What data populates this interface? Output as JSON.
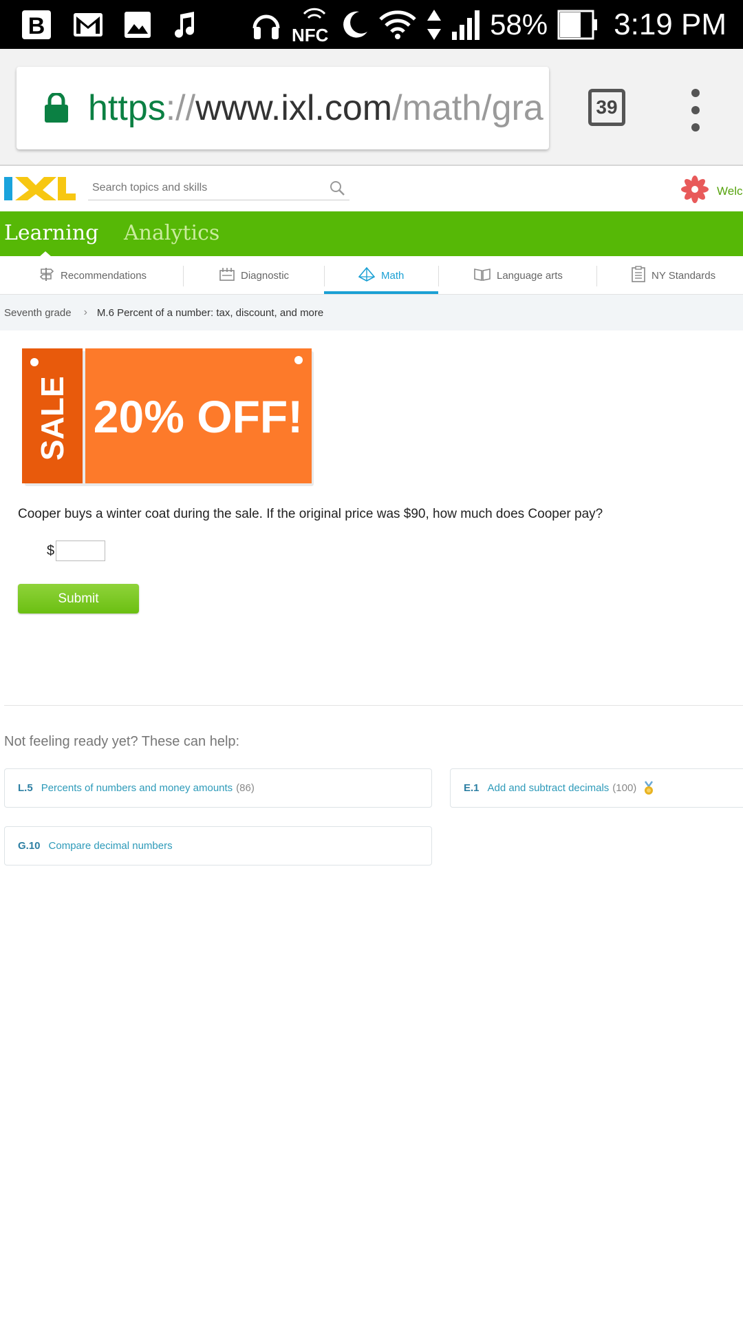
{
  "status_bar": {
    "icons": [
      "b-app-icon",
      "gmail-icon",
      "gallery-icon",
      "music-note-icon",
      "headphones-icon",
      "nfc-icon",
      "moon-icon",
      "wifi-icon",
      "data-arrows-icon",
      "signal-icon"
    ],
    "battery": "58%",
    "time": "3:19 PM"
  },
  "browser": {
    "url_scheme": "https",
    "url_sep": "://",
    "url_host": "www.ixl.com",
    "url_path": "/math/gra",
    "tab_count": "39",
    "lock_color": "#0b8043"
  },
  "header": {
    "logo_text": "IXL",
    "search_placeholder": "Search topics and skills",
    "welcome": "Welcome"
  },
  "main_nav": {
    "learning": "Learning",
    "analytics": "Analytics"
  },
  "subject_tabs": [
    {
      "label": "Recommendations",
      "icon": "signpost-icon"
    },
    {
      "label": "Diagnostic",
      "icon": "diagnostic-icon"
    },
    {
      "label": "Math",
      "icon": "pyramid-icon"
    },
    {
      "label": "Language arts",
      "icon": "book-icon"
    },
    {
      "label": "NY Standards",
      "icon": "clipboard-icon"
    }
  ],
  "breadcrumb": {
    "grade": "Seventh grade",
    "skill": "M.6 Percent of a number: tax, discount, and more"
  },
  "sale_sign": {
    "side_text": "SALE",
    "main_text": "20% OFF!",
    "colors": {
      "side": "#e85a0c",
      "main": "#fd7a2a"
    }
  },
  "question": {
    "text": "Cooper buys a winter coat during the sale. If the original price was $90, how much does Cooper pay?",
    "currency": "$",
    "answer_value": "",
    "submit_label": "Submit"
  },
  "help": {
    "title": "Not feeling ready yet? These can help:",
    "skills": [
      {
        "code": "L.5",
        "name": "Percents of numbers and money amounts",
        "score": "(86)",
        "medal": false
      },
      {
        "code": "E.1",
        "name": "Add and subtract decimals",
        "score": "(100)",
        "medal": true
      },
      {
        "code": "G.10",
        "name": "Compare decimal numbers",
        "score": "",
        "medal": false
      }
    ]
  },
  "colors": {
    "green_nav": "#56b806",
    "math_blue": "#1ba0d4",
    "submit_green": "#7cc823"
  }
}
